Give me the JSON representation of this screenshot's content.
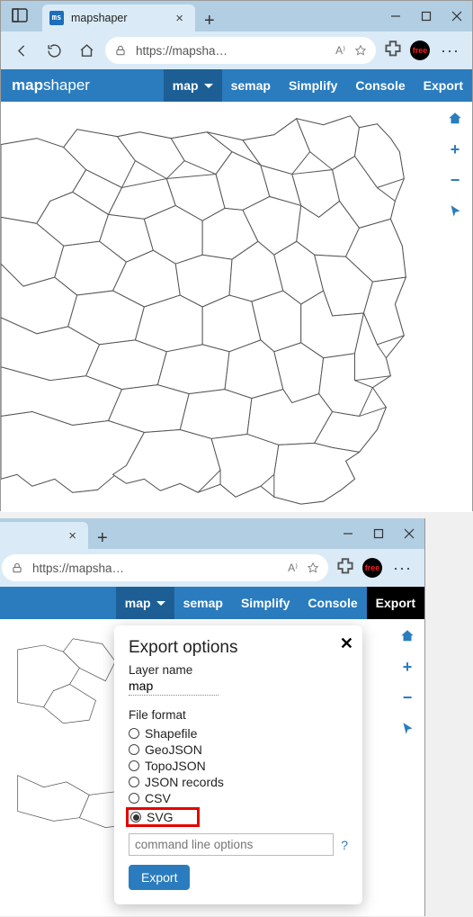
{
  "browser": {
    "tab_title": "mapshaper",
    "favicon_text": "ms",
    "url_display": "https://mapsha…",
    "ext_label": "free"
  },
  "app": {
    "brand_prefix": "map",
    "brand_suffix": "shaper",
    "brand_suffix_short": "er",
    "nav": {
      "map": "map",
      "semap": "semap",
      "simplify": "Simplify",
      "console": "Console",
      "export": "Export"
    }
  },
  "tools": {
    "home": "⇧",
    "plus": "+",
    "minus": "−",
    "pointer": "➤"
  },
  "dialog": {
    "title": "Export options",
    "layer_label": "Layer name",
    "layer_value": "map",
    "format_label": "File format",
    "formats": {
      "shapefile": "Shapefile",
      "geojson": "GeoJSON",
      "topojson": "TopoJSON",
      "json_records": "JSON records",
      "csv": "CSV",
      "svg": "SVG"
    },
    "cmd_placeholder": "command line options",
    "help": "?",
    "export_btn": "Export"
  }
}
